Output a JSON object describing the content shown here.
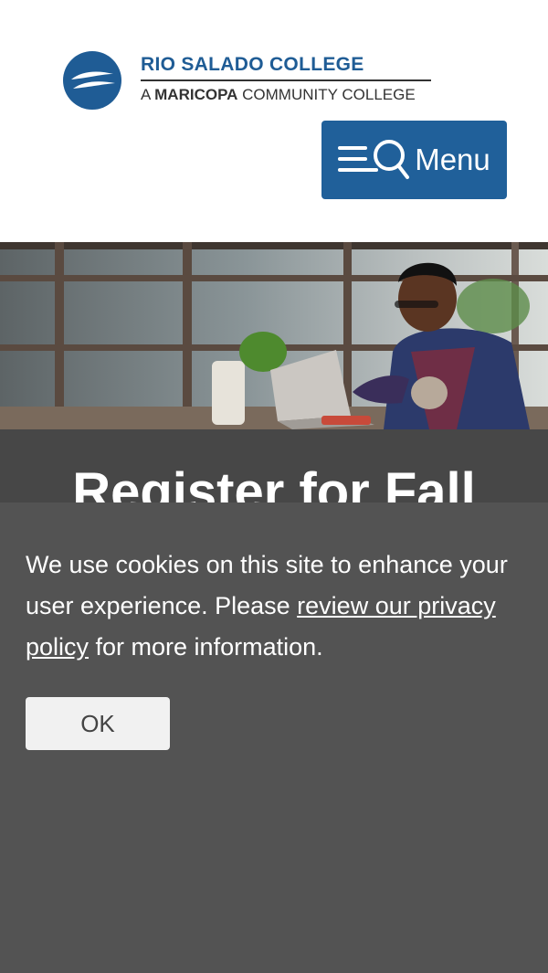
{
  "header": {
    "logo": {
      "name": "RIO SALADO COLLEGE",
      "sub_prefix": "A ",
      "sub_bold": "MARICOPA",
      "sub_suffix": " COMMUNITY COLLEGE",
      "brand_color": "#1f5c95"
    },
    "menu_button": {
      "label": "Menu",
      "icon": "menu-search-icon",
      "background": "#20609a"
    }
  },
  "hero": {
    "image": "student-with-laptop-photo"
  },
  "banner": {
    "title": "Register for Fall",
    "background": "#474747"
  },
  "cookie_notice": {
    "text_before": "We use cookies on this site to enhance your user experience. Please ",
    "link_text": "review our privacy policy",
    "text_after": " for more information.",
    "ok_label": "OK",
    "background": "#535353"
  }
}
